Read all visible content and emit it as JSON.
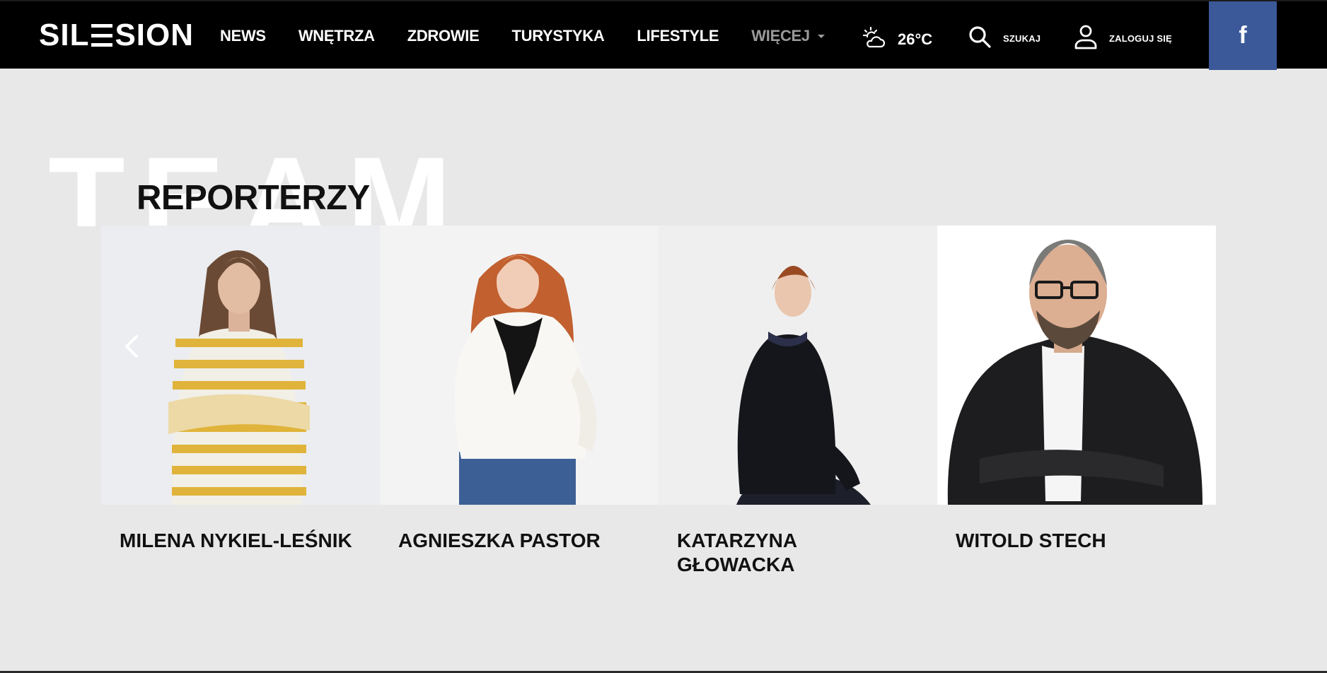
{
  "brand": {
    "logo_left": "SIL",
    "logo_right": "SION"
  },
  "nav": {
    "items": [
      {
        "label": "NEWS"
      },
      {
        "label": "WNĘTRZA"
      },
      {
        "label": "ZDROWIE"
      },
      {
        "label": "TURYSTYKA"
      },
      {
        "label": "LIFESTYLE"
      }
    ],
    "more_label": "WIĘCEJ"
  },
  "weather": {
    "temperature": "26°C",
    "icon": "partly-cloudy-icon"
  },
  "search": {
    "label": "SZUKAJ",
    "icon": "search-icon"
  },
  "login": {
    "label": "ZALOGUJ SIĘ",
    "icon": "user-icon"
  },
  "social": {
    "facebook_glyph": "f",
    "color": "#3b5998"
  },
  "section": {
    "background_word": "TEAM",
    "title": "REPORTERZY"
  },
  "reporters": [
    {
      "name": "MILENA NYKIEL-LEŚNIK"
    },
    {
      "name": "AGNIESZKA PASTOR"
    },
    {
      "name": "KATARZYNA GŁOWACKA"
    },
    {
      "name": "WITOLD STECH"
    }
  ],
  "colors": {
    "topbar": "#000000",
    "page_bg": "#e8e8e8",
    "facebook": "#3b5998"
  }
}
